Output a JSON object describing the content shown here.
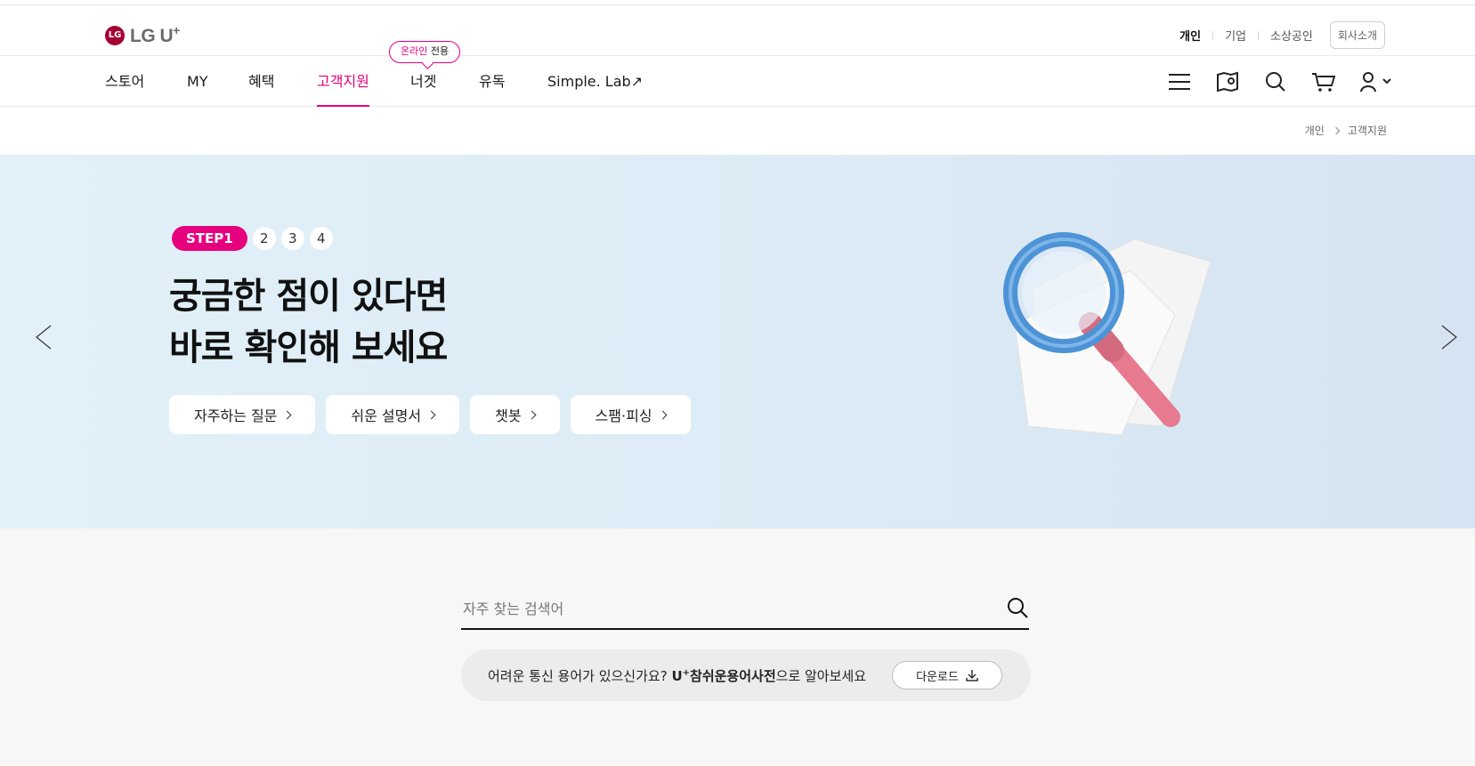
{
  "logo": {
    "mark": "LG",
    "text": "LG U",
    "sup": "+"
  },
  "utility": {
    "links": [
      {
        "label": "개인"
      },
      {
        "label": "기업"
      },
      {
        "label": "소상공인"
      }
    ],
    "company_button": "회사소개"
  },
  "gnb": {
    "items": [
      {
        "label": "스토어"
      },
      {
        "label": "MY"
      },
      {
        "label": "혜택"
      },
      {
        "label": "고객지원"
      },
      {
        "label": "너겟"
      },
      {
        "label": "유독"
      },
      {
        "label": "Simple. Lab↗"
      }
    ],
    "online_badge": {
      "pink": "온라인",
      "text": " 전용"
    }
  },
  "breadcrumb": {
    "home": "개인",
    "current": "고객지원"
  },
  "hero": {
    "steps": {
      "active": "STEP1",
      "others": [
        "2",
        "3",
        "4"
      ]
    },
    "title_line1": "궁금한 점이 있다면",
    "title_line2": "바로 확인해 보세요",
    "buttons": [
      {
        "label": "자주하는 질문"
      },
      {
        "label": "쉬운 설명서"
      },
      {
        "label": "챗봇"
      },
      {
        "label": "스팸·피싱"
      }
    ]
  },
  "search": {
    "placeholder": "자주 찾는 검색어"
  },
  "dictionary": {
    "text_before": "어려운 통신 용어가 있으신가요? ",
    "strong_u": "U",
    "strong_sup": "+",
    "strong_rest": "참쉬운용어사전",
    "text_after": "으로 알아보세요",
    "download_label": "다운로드"
  },
  "colors": {
    "accent": "#e6007e",
    "brand": "#a50034",
    "hero_bg": "#dcebf5"
  }
}
